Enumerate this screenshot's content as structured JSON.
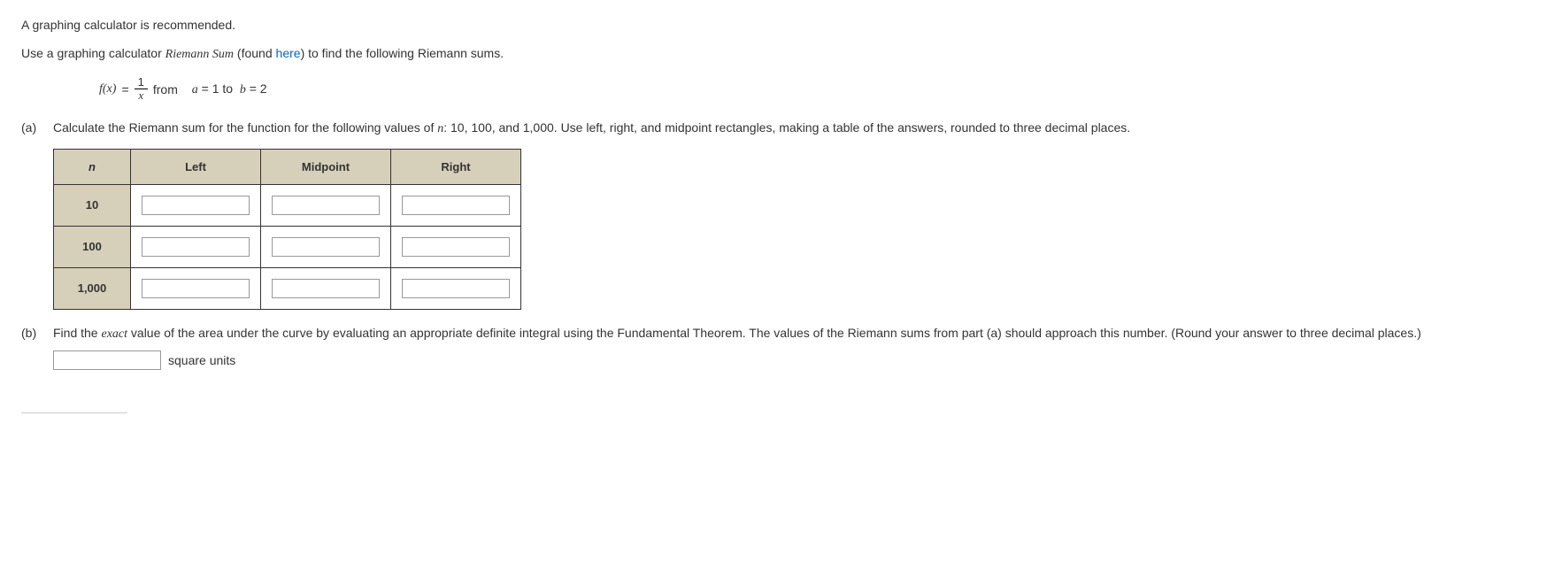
{
  "intro": {
    "line1": "A graphing calculator is recommended.",
    "line2_a": "Use a graphing calculator ",
    "line2_b_italic": "Riemann Sum",
    "line2_c": " (found ",
    "line2_link": "here",
    "line2_d": ") to find the following Riemann sums."
  },
  "formula": {
    "fx": "f(x)",
    "eq": " = ",
    "num": "1",
    "den": "x",
    "from_lbl": " from",
    "a_var": "a",
    "eq1": " = 1  to ",
    "b_var": "b",
    "eq2": " = 2"
  },
  "part_a": {
    "label": "(a)",
    "text_a": "Calculate the Riemann sum for the function for the following values of ",
    "n_var": "n",
    "text_b": ": 10, 100, and 1,000. Use left, right, and midpoint rectangles, making a table of the answers, rounded to three decimal places.",
    "headers": {
      "n": "n",
      "left": "Left",
      "mid": "Midpoint",
      "right": "Right"
    },
    "rows": [
      {
        "n": "10"
      },
      {
        "n": "100"
      },
      {
        "n": "1,000"
      }
    ]
  },
  "part_b": {
    "label": "(b)",
    "text_a": "Find the ",
    "exact": "exact",
    "text_b": " value of the area under the curve by evaluating an appropriate definite integral using the Fundamental Theorem. The values of the Riemann sums from part (a) should approach this number. (Round your answer to three decimal places.)",
    "units": "square units"
  }
}
